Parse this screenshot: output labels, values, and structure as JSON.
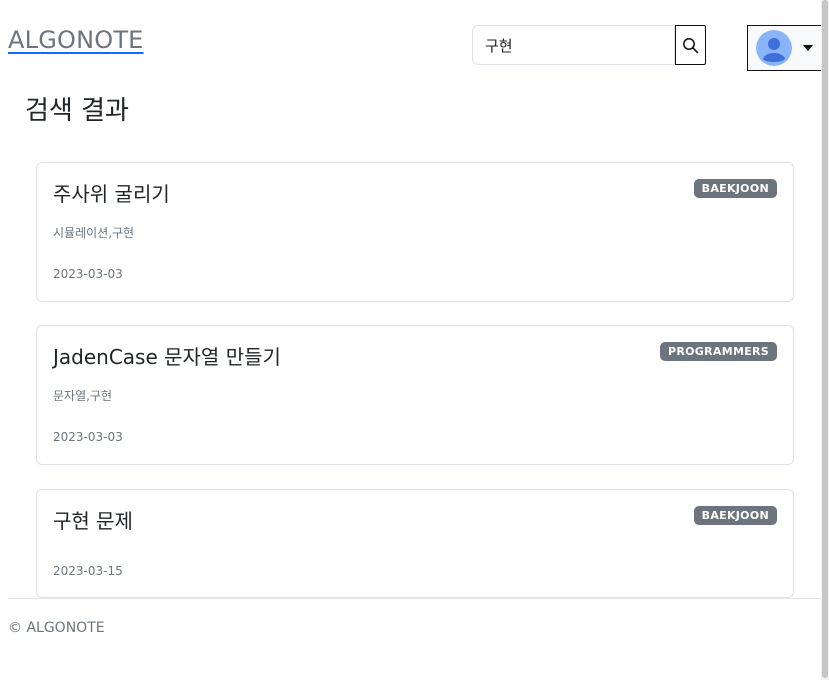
{
  "header": {
    "logo": "ALGONOTE",
    "search": {
      "value": "구현",
      "placeholder": ""
    },
    "search_icon": "search-icon",
    "user_icon": "user-avatar-icon"
  },
  "main": {
    "title": "검색 결과",
    "results": [
      {
        "title": "주사위 굴리기",
        "badge": "BAEKJOON",
        "tags": "시뮬레이션,구현",
        "date": "2023-03-03"
      },
      {
        "title": "JadenCase 문자열 만들기",
        "badge": "PROGRAMMERS",
        "tags": "문자열,구현",
        "date": "2023-03-03"
      },
      {
        "title": "구현 문제",
        "badge": "BAEKJOON",
        "tags": "",
        "date": "2023-03-15"
      }
    ]
  },
  "footer": {
    "text": "© ALGONOTE"
  },
  "colors": {
    "badge": "#6c757d",
    "logo_underline": "#0d6efd",
    "avatar_bg": "#8ab4f8",
    "avatar_fg": "#3f6fd8"
  }
}
